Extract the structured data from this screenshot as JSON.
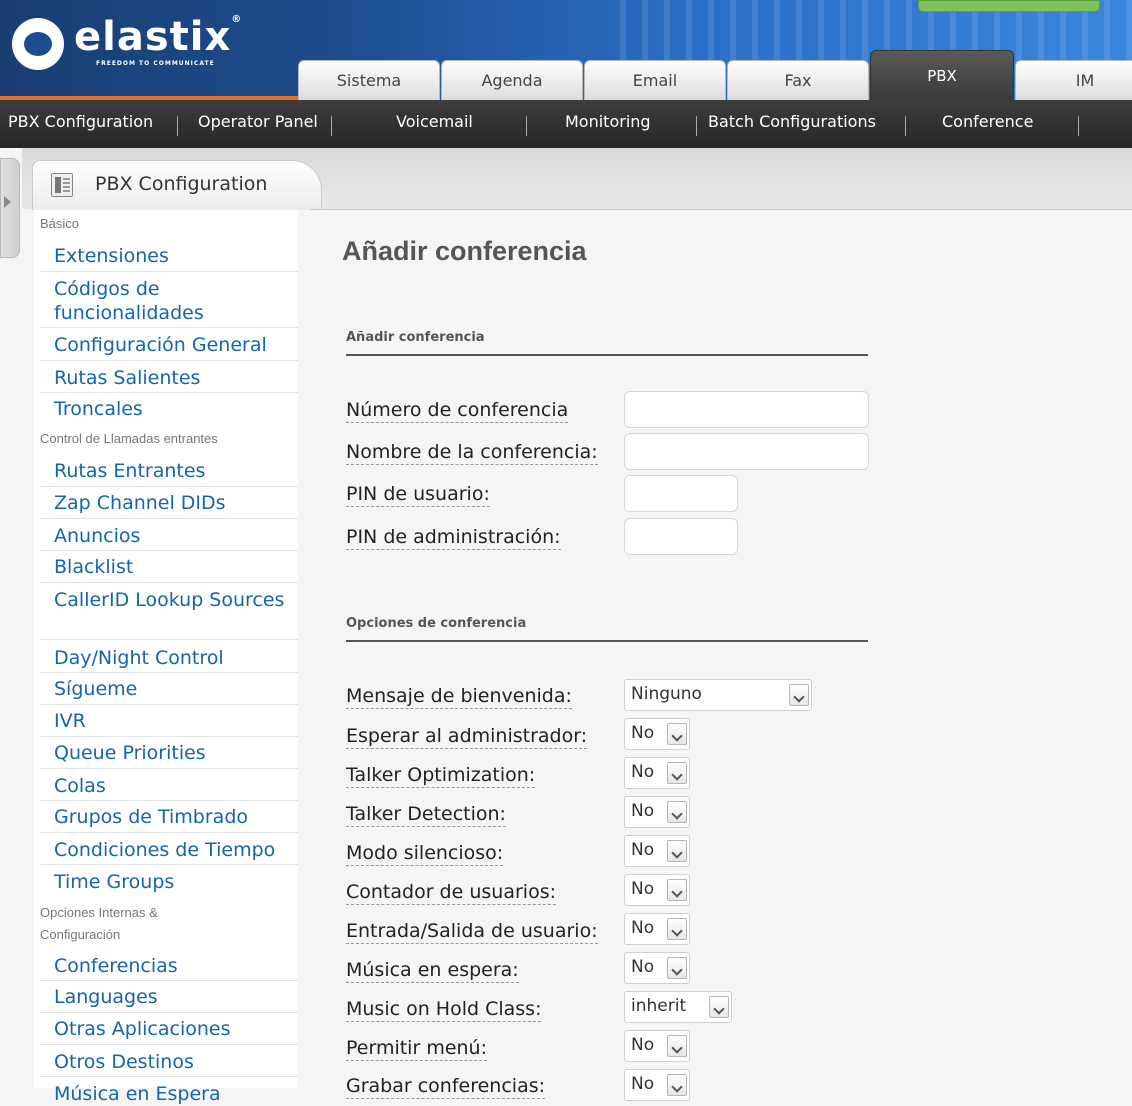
{
  "logo": {
    "word": "elastix",
    "tagline": "FREEDOM TO COMMUNICATE"
  },
  "top_tabs": [
    "Sistema",
    "Agenda",
    "Email",
    "Fax",
    "PBX",
    "IM"
  ],
  "active_top_tab": "PBX",
  "sub_nav": [
    "PBX Configuration",
    "Operator Panel",
    "Voicemail",
    "Monitoring",
    "Batch Configurations",
    "Conference"
  ],
  "panel_tab": {
    "title": "PBX Configuration"
  },
  "sidebar": {
    "sections": [
      {
        "header": "Básico",
        "items": [
          "Extensiones",
          "Códigos de funcionalidades",
          "Configuración General",
          "Rutas Salientes",
          "Troncales"
        ]
      },
      {
        "header": "Control de Llamadas entrantes",
        "items": [
          "Rutas Entrantes",
          "Zap Channel DIDs",
          "Anuncios",
          "Blacklist",
          "CallerID Lookup Sources",
          "Day/Night Control",
          "Sígueme",
          "IVR",
          "Queue Priorities",
          "Colas",
          "Grupos de Timbrado",
          "Condiciones de Tiempo",
          "Time Groups"
        ]
      },
      {
        "header": "Opciones Internas & Configuración",
        "items": [
          "Conferencias",
          "Languages",
          "Otras Aplicaciones",
          "Otros Destinos",
          "Música en Espera"
        ]
      }
    ]
  },
  "page": {
    "title": "Añadir conferencia",
    "section1": "Añadir conferencia",
    "section2": "Opciones de conferencia",
    "fields": [
      {
        "label": "Número de conferencia",
        "value": ""
      },
      {
        "label": "Nombre de la conferencia:",
        "value": ""
      },
      {
        "label": "PIN de usuario:",
        "value": ""
      },
      {
        "label": "PIN de administración:",
        "value": ""
      }
    ],
    "options": [
      {
        "label": "Mensaje de bienvenida:",
        "value": "Ninguno"
      },
      {
        "label": "Esperar al administrador:",
        "value": "No"
      },
      {
        "label": "Talker Optimization:",
        "value": "No"
      },
      {
        "label": "Talker Detection:",
        "value": "No"
      },
      {
        "label": "Modo silencioso:",
        "value": "No"
      },
      {
        "label": "Contador de usuarios:",
        "value": "No"
      },
      {
        "label": "Entrada/Salida de usuario:",
        "value": "No"
      },
      {
        "label": "Música en espera:",
        "value": "No"
      },
      {
        "label": "Music on Hold Class:",
        "value": "inherit"
      },
      {
        "label": "Permitir menú:",
        "value": "No"
      },
      {
        "label": "Grabar conferencias:",
        "value": "No"
      }
    ]
  },
  "colors": {
    "accent_orange": "#e8702a",
    "link_blue": "#1565a9",
    "header_blue": "#1c4d8e"
  }
}
